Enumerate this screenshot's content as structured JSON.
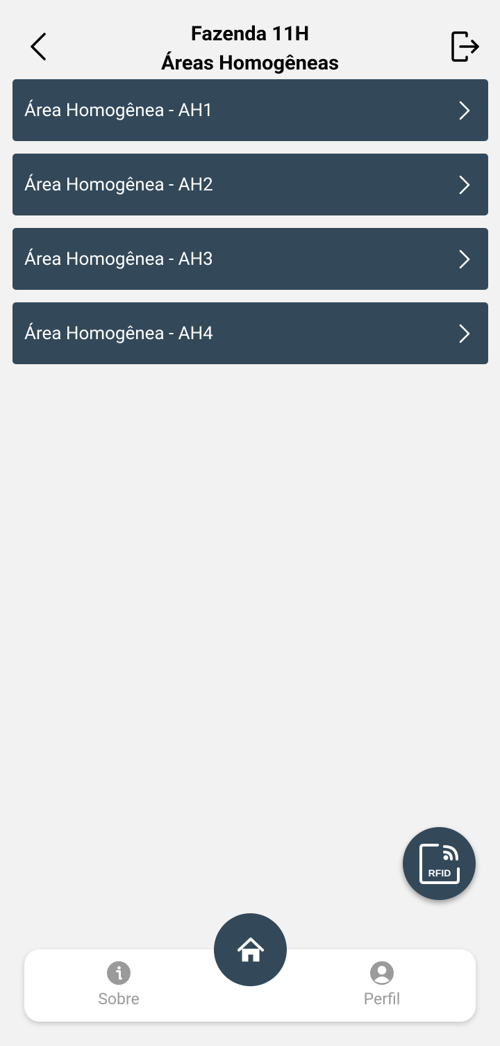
{
  "header": {
    "title": "Fazenda 11H",
    "subtitle": "Áreas Homogêneas",
    "back_icon": "chevron-left-icon",
    "logout_icon": "logout-icon"
  },
  "list": {
    "items": [
      {
        "label": "Área Homogênea - AH1"
      },
      {
        "label": "Área Homogênea - AH2"
      },
      {
        "label": "Área Homogênea - AH3"
      },
      {
        "label": "Área Homogênea - AH4"
      }
    ],
    "item_icon": "chevron-right-icon"
  },
  "fab": {
    "label": "RFID",
    "icon": "rfid-icon"
  },
  "bottom_nav": {
    "sobre": {
      "label": "Sobre",
      "icon": "info-icon"
    },
    "home": {
      "icon": "home-icon"
    },
    "perfil": {
      "label": "Perfil",
      "icon": "user-icon"
    }
  },
  "colors": {
    "background": "#f2f2f2",
    "primary": "#33495a",
    "nav_inactive": "#9a9a9a"
  }
}
